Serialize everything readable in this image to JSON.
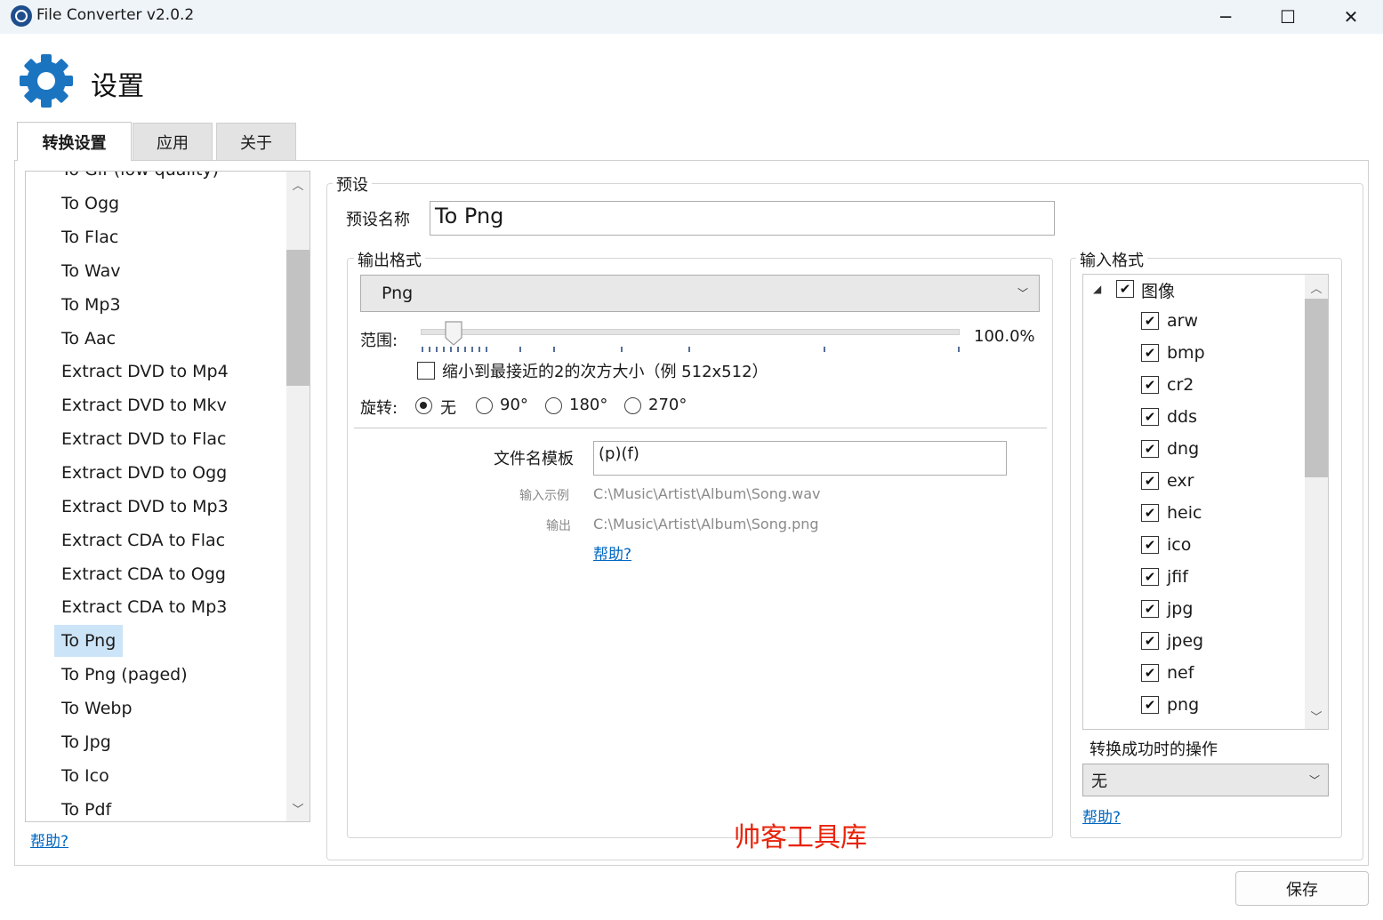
{
  "window": {
    "title": "File Converter v2.0.2",
    "minimize": "─",
    "maximize": "☐",
    "close": "✕"
  },
  "header": {
    "title": "设置",
    "icon": "gear-icon",
    "accent": "#1b74c0"
  },
  "tabs": [
    {
      "label": "转换设置",
      "active": true
    },
    {
      "label": "应用",
      "active": false
    },
    {
      "label": "关于",
      "active": false
    }
  ],
  "preset_list": {
    "items": [
      "To Gif (low quality)",
      "To Ogg",
      "To Flac",
      "To Wav",
      "To Mp3",
      "To Aac",
      "Extract DVD to Mp4",
      "Extract DVD to Mkv",
      "Extract DVD to Flac",
      "Extract DVD to Ogg",
      "Extract DVD to Mp3",
      "Extract CDA to Flac",
      "Extract CDA to Ogg",
      "Extract CDA to Mp3",
      "To Png",
      "To Png (paged)",
      "To Webp",
      "To Jpg",
      "To Ico",
      "To Pdf"
    ],
    "selected": "To Png",
    "help_link": "帮助?"
  },
  "preset": {
    "group_label": "预设",
    "name_label": "预设名称",
    "name_value": "To Png",
    "output_format": {
      "group_label": "输出格式",
      "selected": "Png",
      "range_label": "范围:",
      "range_value": "100.0%",
      "slider_fraction": 0.06,
      "resize_pow2_label": "缩小到最接近的2的次方大小（例 512x512）",
      "resize_pow2_checked": false,
      "rotation_label": "旋转:",
      "rotation_options": [
        "无",
        "90°",
        "180°",
        "270°"
      ],
      "rotation_selected": "无",
      "filename_template_label": "文件名模板",
      "filename_template_value": "(p)(f)",
      "input_example_label": "输入示例",
      "input_example_value": "C:\\Music\\Artist\\Album\\Song.wav",
      "output_label": "输出",
      "output_value": "C:\\Music\\Artist\\Album\\Song.png",
      "help_link": "帮助?"
    },
    "input_formats": {
      "group_label": "输入格式",
      "category": "图像",
      "items": [
        "arw",
        "bmp",
        "cr2",
        "dds",
        "dng",
        "exr",
        "heic",
        "ico",
        "jfif",
        "jpg",
        "jpeg",
        "nef",
        "png"
      ],
      "on_success_label": "转换成功时的操作",
      "on_success_value": "无",
      "help_link": "帮助?"
    }
  },
  "watermark": "帅客工具库",
  "save_button": "保存"
}
